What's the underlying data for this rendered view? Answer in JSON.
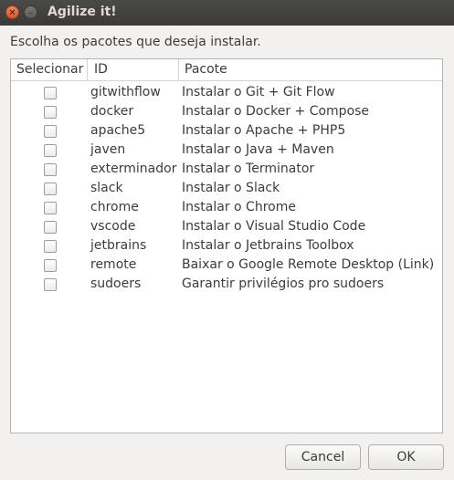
{
  "window": {
    "title": "Agilize it!"
  },
  "prompt": "Escolha os pacotes que deseja instalar.",
  "columns": {
    "select": "Selecionar",
    "id": "ID",
    "package": "Pacote"
  },
  "rows": [
    {
      "checked": false,
      "id": "gitwithflow",
      "package": "Instalar o Git + Git Flow"
    },
    {
      "checked": false,
      "id": "docker",
      "package": "Instalar o Docker + Compose"
    },
    {
      "checked": false,
      "id": "apache5",
      "package": "Instalar o Apache + PHP5"
    },
    {
      "checked": false,
      "id": "javen",
      "package": "Instalar o Java + Maven"
    },
    {
      "checked": false,
      "id": "exterminador",
      "package": "Instalar o Terminator"
    },
    {
      "checked": false,
      "id": "slack",
      "package": "Instalar o Slack"
    },
    {
      "checked": false,
      "id": "chrome",
      "package": "Instalar o Chrome"
    },
    {
      "checked": false,
      "id": "vscode",
      "package": "Instalar o Visual Studio Code"
    },
    {
      "checked": false,
      "id": "jetbrains",
      "package": "Instalar o Jetbrains Toolbox"
    },
    {
      "checked": false,
      "id": "remote",
      "package": "Baixar o Google Remote Desktop (Link)"
    },
    {
      "checked": false,
      "id": "sudoers",
      "package": "Garantir privilégios pro sudoers"
    }
  ],
  "buttons": {
    "cancel": "Cancel",
    "ok": "OK"
  },
  "titlebar_icons": {
    "close": "close-icon",
    "minimize": "minimize-icon"
  }
}
